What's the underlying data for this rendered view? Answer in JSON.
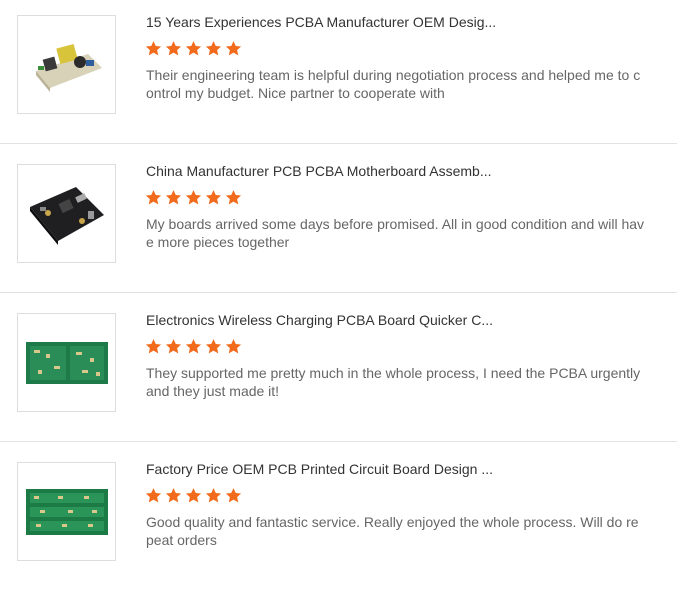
{
  "colors": {
    "star": "#f26b1d",
    "title": "#333333",
    "review": "#666666",
    "divider": "#e2e2e2"
  },
  "reviews": [
    {
      "title": "15 Years Experiences PCBA Manufacturer OEM Desig...",
      "rating": 5,
      "text": "Their engineering team is helpful during negotiation process and helped me to control my budget.  Nice partner to cooperate with",
      "image_icon": "power-module-pcb-icon"
    },
    {
      "title": "China Manufacturer PCB PCBA Motherboard Assemb...",
      "rating": 5,
      "text": "My boards arrived some days before promised.  All in good condition and will have more pieces together",
      "image_icon": "black-motherboard-pcb-icon"
    },
    {
      "title": "Electronics Wireless Charging PCBA Board Quicker C...",
      "rating": 5,
      "text": "They supported me pretty much in the whole process, I need the PCBA urgently and they just made it!",
      "image_icon": "green-panel-pcb-icon"
    },
    {
      "title": "Factory Price OEM PCB Printed Circuit Board Design ...",
      "rating": 5,
      "text": "Good quality and fantastic service.  Really enjoyed the whole process.  Will do repeat orders",
      "image_icon": "green-strip-pcb-icon"
    }
  ]
}
